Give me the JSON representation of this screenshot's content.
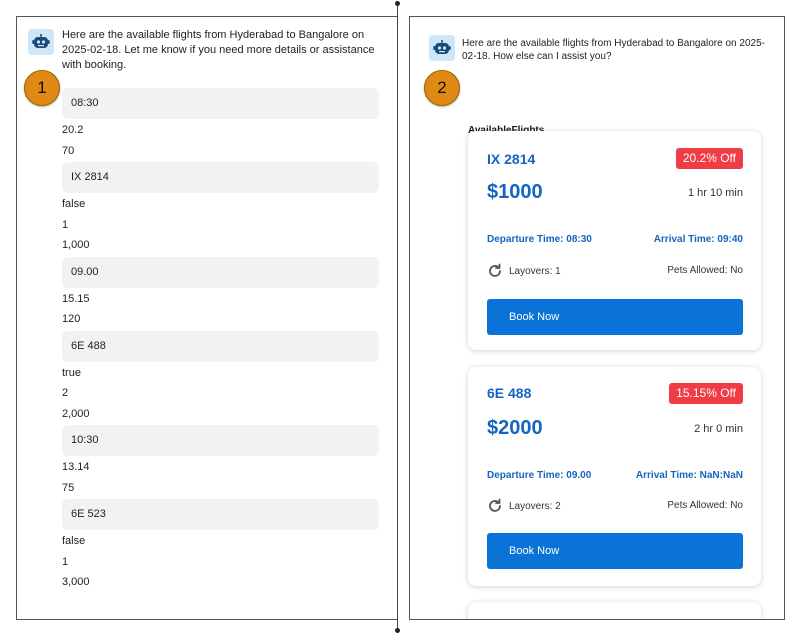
{
  "left": {
    "message": "Here are the available flights from Hyderabad to Bangalore on 2025-02-18. Let me know if you need more details or assistance with booking.",
    "badge": "1",
    "items": [
      {
        "kind": "pill",
        "text": "08:30"
      },
      {
        "kind": "text",
        "text": "20.2"
      },
      {
        "kind": "text",
        "text": "70"
      },
      {
        "kind": "pill",
        "text": "IX 2814"
      },
      {
        "kind": "text",
        "text": "false"
      },
      {
        "kind": "text",
        "text": "1"
      },
      {
        "kind": "text",
        "text": "1,000"
      },
      {
        "kind": "pill",
        "text": "09.00"
      },
      {
        "kind": "text",
        "text": "15.15"
      },
      {
        "kind": "text",
        "text": "120"
      },
      {
        "kind": "pill",
        "text": "6E 488"
      },
      {
        "kind": "text",
        "text": "true"
      },
      {
        "kind": "text",
        "text": "2"
      },
      {
        "kind": "text",
        "text": "2,000"
      },
      {
        "kind": "pill",
        "text": "10:30"
      },
      {
        "kind": "text",
        "text": "13.14"
      },
      {
        "kind": "text",
        "text": "75"
      },
      {
        "kind": "pill",
        "text": "6E 523"
      },
      {
        "kind": "text",
        "text": "false"
      },
      {
        "kind": "text",
        "text": "1"
      },
      {
        "kind": "text",
        "text": "3,000"
      }
    ]
  },
  "right": {
    "message": "Here are the available flights from Hyderabad to Bangalore on 2025-02-18. How else can I assist you?",
    "badge": "2",
    "heading": "AvailableFlights",
    "cards": [
      {
        "code": "IX 2814",
        "discount": "20.2% Off",
        "price": "$1000",
        "duration": "1 hr 10 min",
        "departure": "Departure Time: 08:30",
        "arrival": "Arrival Time: 09:40",
        "layovers": "Layovers: 1",
        "pets": "Pets Allowed: No",
        "button": "Book Now"
      },
      {
        "code": "6E 488",
        "discount": "15.15% Off",
        "price": "$2000",
        "duration": "2 hr 0 min",
        "departure": "Departure Time: 09.00",
        "arrival": "Arrival Time: NaN:NaN",
        "layovers": "Layovers: 2",
        "pets": "Pets Allowed: No",
        "button": "Book Now"
      }
    ]
  },
  "colors": {
    "accent": "#0b72d8",
    "link": "#1565c0",
    "discount": "#ef3c45",
    "badge": "#e08a13",
    "pill": "#f2f2f2"
  }
}
